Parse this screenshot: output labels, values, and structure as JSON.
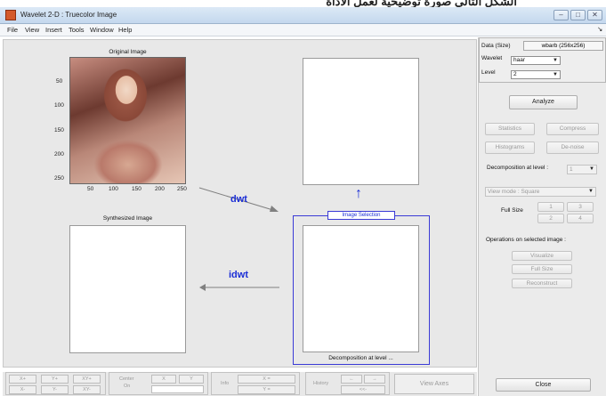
{
  "overlay_caption": "الشكل التالي صورة توضيحية لعمل الأداة",
  "window": {
    "title": "Wavelet 2-D : Truecolor Image",
    "controls": [
      "–",
      "□",
      "✕"
    ]
  },
  "menu": [
    "File",
    "View",
    "Insert",
    "Tools",
    "Window",
    "Help"
  ],
  "main": {
    "original_title": "Original Image",
    "synth_title": "Synthesized Image",
    "image_selection_label": "Image Selection",
    "decomp_caption": "Decomposition at level ...",
    "dwt_label": "dwt",
    "idwt_label": "idwt",
    "up_arrow": "↑",
    "y_ticks": [
      "50",
      "100",
      "150",
      "200",
      "250"
    ],
    "x_ticks": [
      "50",
      "100",
      "150",
      "200",
      "250"
    ],
    "colors": {
      "arrow": "#808080",
      "label": "#1c2fd6",
      "selection_box": "#3a3ad6"
    }
  },
  "panel": {
    "data_label": "Data (Size)",
    "data_value": "wbarb (256x256)",
    "wavelet_label": "Wavelet",
    "wavelet_value": "haar",
    "level_label": "Level",
    "level_value": "2",
    "analyze": "Analyze",
    "statistics": "Statistics",
    "compress": "Compress",
    "histograms": "Histograms",
    "denoise": "De-noise",
    "decomp_level_label": "Decomposition at level :",
    "decomp_level_value": "1",
    "view_mode": "View mode : Square",
    "full_size_label": "Full Size",
    "full_size_buttons": [
      "1",
      "2",
      "3",
      "4"
    ],
    "ops_label": "Operations on selected image :",
    "visualize": "Visualize",
    "fullsize": "Full Size",
    "reconstruct": "Reconstruct",
    "close": "Close"
  },
  "toolbar": {
    "xplus": "X+",
    "yplus": "Y+",
    "xyplus": "XY+",
    "xminus": "X-",
    "yminus": "Y-",
    "xyminus": "XY-",
    "center": "Center",
    "on": "On",
    "x_btn": "X",
    "y_btn": "Y",
    "info": "Info",
    "x_eq": "X =",
    "y_eq": "Y =",
    "history": "History",
    "view_axes": "View Axes",
    "left_arrow": "←",
    "right_arrow": "→",
    "double_left": "<<-"
  }
}
